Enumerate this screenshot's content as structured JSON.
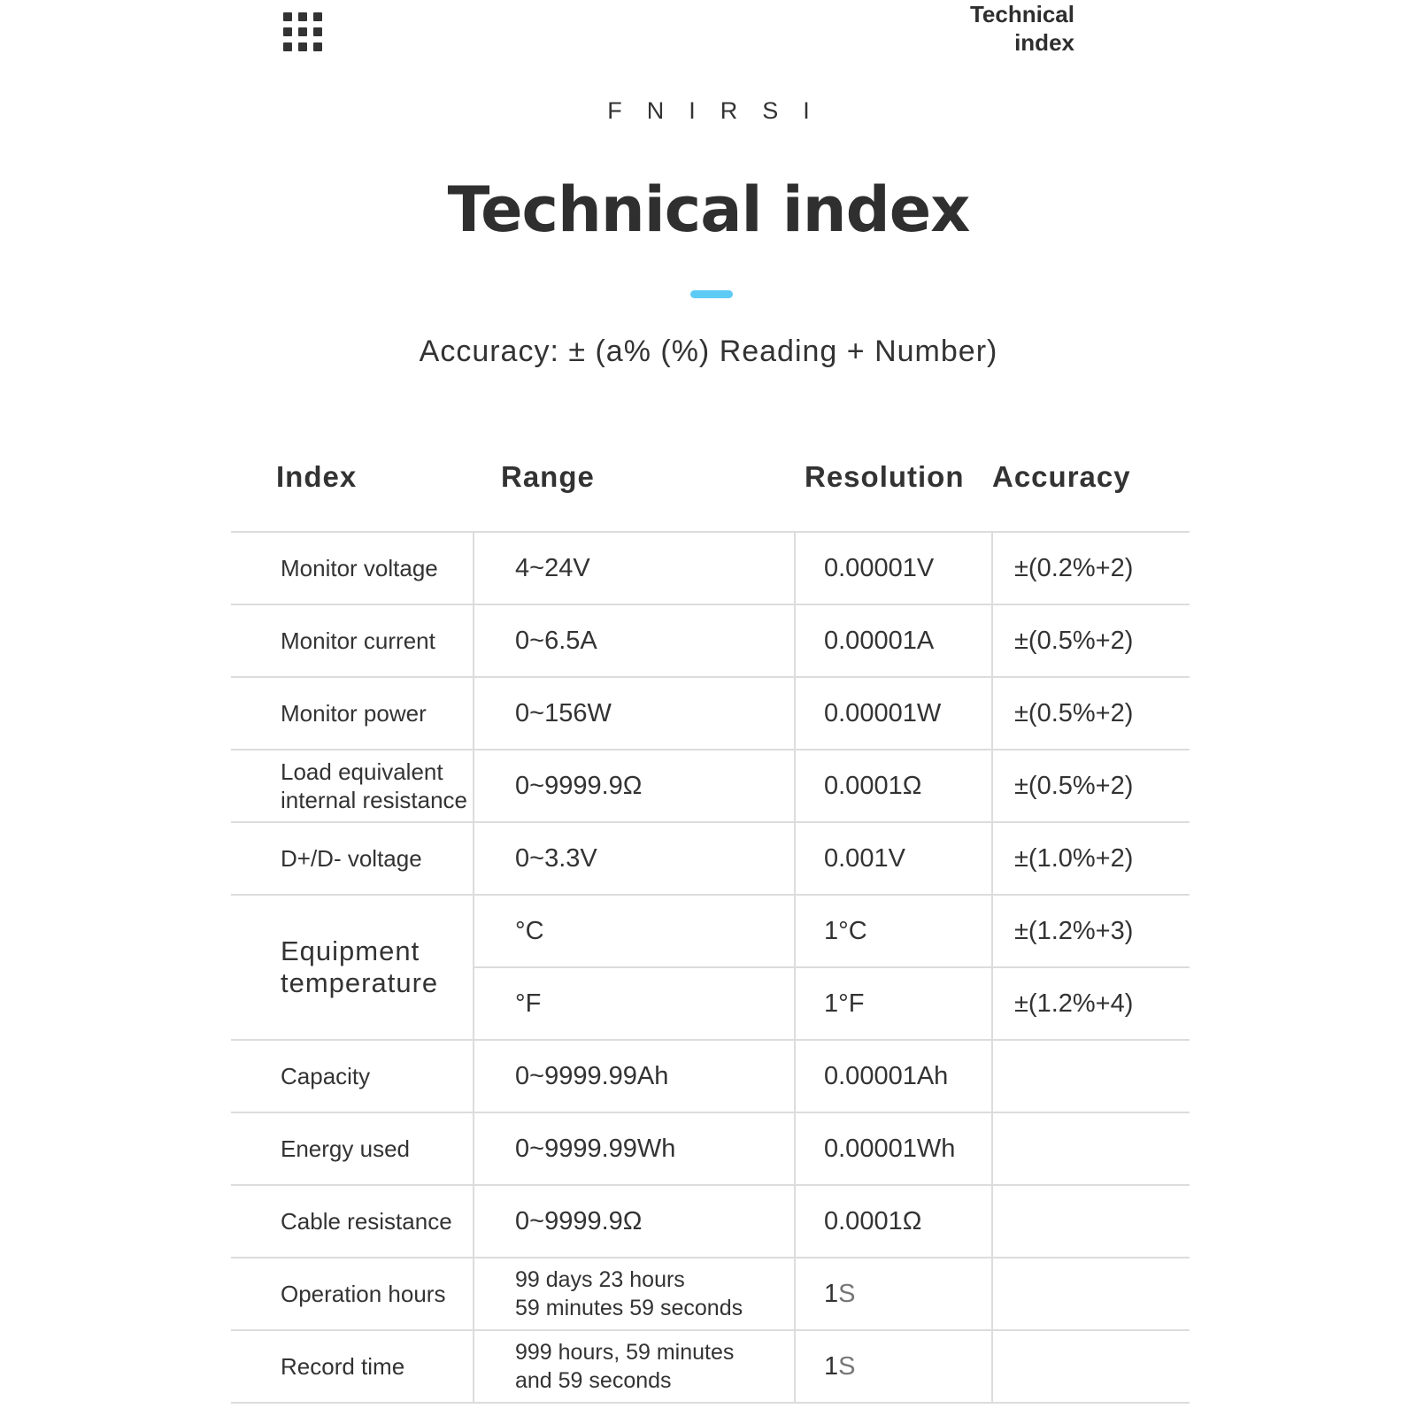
{
  "header": {
    "menu_icon": "grid-menu-icon",
    "corner_title_line1": "Technical",
    "corner_title_line2": "index",
    "brand": "FNIRSI",
    "title": "Technical index",
    "accent_color": "#5ecbf5",
    "accuracy_note": "Accuracy: ± (a% (%) Reading + Number)"
  },
  "table": {
    "headers": [
      "Index",
      "Range",
      "Resolution",
      "Accuracy"
    ],
    "rows": [
      {
        "index": "Monitor voltage",
        "range": "4~24V",
        "resolution": "0.00001V",
        "accuracy": "±(0.2%+2)"
      },
      {
        "index": "Monitor current",
        "range": "0~6.5A",
        "resolution": "0.00001A",
        "accuracy": "±(0.5%+2)"
      },
      {
        "index": "Monitor power",
        "range": "0~156W",
        "resolution": "0.00001W",
        "accuracy": "±(0.5%+2)"
      },
      {
        "index_line1": "Load equivalent",
        "index_line2": "internal resistance",
        "range": "0~9999.9Ω",
        "resolution": "0.0001Ω",
        "accuracy": "±(0.5%+2)"
      },
      {
        "index": "D+/D- voltage",
        "range": "0~3.3V",
        "resolution": "0.001V",
        "accuracy": "±(1.0%+2)"
      },
      {
        "index_line1": "Equipment",
        "index_line2": "temperature",
        "sub": [
          {
            "range": "°C",
            "resolution": "1°C",
            "accuracy": "±(1.2%+3)"
          },
          {
            "range": "°F",
            "resolution": "1°F",
            "accuracy": "±(1.2%+4)"
          }
        ]
      },
      {
        "index": "Capacity",
        "range": "0~9999.99Ah",
        "resolution": "0.00001Ah",
        "accuracy": ""
      },
      {
        "index": "Energy used",
        "range": "0~9999.99Wh",
        "resolution": "0.00001Wh",
        "accuracy": ""
      },
      {
        "index": "Cable resistance",
        "range": "0~9999.9Ω",
        "resolution": "0.0001Ω",
        "accuracy": ""
      },
      {
        "index": "Operation hours",
        "range_line1": "99 days 23 hours",
        "range_line2": "59 minutes 59 seconds",
        "resolution_num": "1",
        "resolution_unit": "S",
        "accuracy": ""
      },
      {
        "index": "Record time",
        "range_line1": "999 hours, 59 minutes",
        "range_line2": "and 59 seconds",
        "resolution_num": "1",
        "resolution_unit": "S",
        "accuracy": ""
      }
    ]
  }
}
